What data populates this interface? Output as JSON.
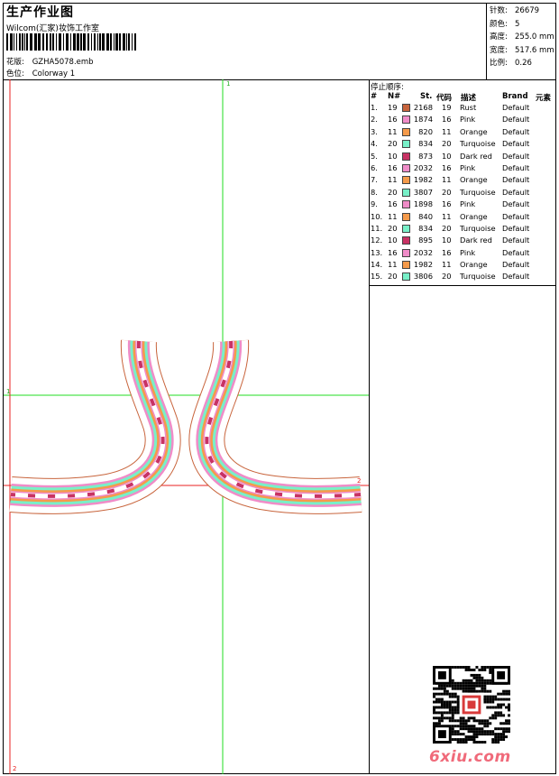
{
  "header": {
    "title": "生产作业图",
    "company": "Wilcom(汇家)妆饰工作室",
    "design_label": "花版:",
    "design_value": "GZHA5078.emb",
    "colorway_label": "色位:",
    "colorway_value": "Colorway 1"
  },
  "stats": [
    {
      "label": "针数:",
      "value": "26679"
    },
    {
      "label": "颜色:",
      "value": "5"
    },
    {
      "label": "高度:",
      "value": "255.0 mm"
    },
    {
      "label": "宽度:",
      "value": "517.6 mm"
    },
    {
      "label": "比例:",
      "value": "0.26"
    }
  ],
  "stop_sequence": {
    "title": "停止顺序:",
    "columns": {
      "n": "#",
      "needle": "N#",
      "st": "St.",
      "code": "代码",
      "desc": "描述",
      "brand": "Brand",
      "element": "元素"
    },
    "rows": [
      {
        "n": "1.",
        "needle": "19",
        "color": "#c8643c",
        "st": "2168",
        "code": "19",
        "desc": "Rust",
        "brand": "Default"
      },
      {
        "n": "2.",
        "needle": "16",
        "color": "#f08cc8",
        "st": "1874",
        "code": "16",
        "desc": "Pink",
        "brand": "Default"
      },
      {
        "n": "3.",
        "needle": "11",
        "color": "#f59a4a",
        "st": "820",
        "code": "11",
        "desc": "Orange",
        "brand": "Default"
      },
      {
        "n": "4.",
        "needle": "20",
        "color": "#78f0c8",
        "st": "834",
        "code": "20",
        "desc": "Turquoise",
        "brand": "Default"
      },
      {
        "n": "5.",
        "needle": "10",
        "color": "#c83264",
        "st": "873",
        "code": "10",
        "desc": "Dark red",
        "brand": "Default"
      },
      {
        "n": "6.",
        "needle": "16",
        "color": "#f08cc8",
        "st": "2032",
        "code": "16",
        "desc": "Pink",
        "brand": "Default"
      },
      {
        "n": "7.",
        "needle": "11",
        "color": "#f59a4a",
        "st": "1982",
        "code": "11",
        "desc": "Orange",
        "brand": "Default"
      },
      {
        "n": "8.",
        "needle": "20",
        "color": "#78f0c8",
        "st": "3807",
        "code": "20",
        "desc": "Turquoise",
        "brand": "Default"
      },
      {
        "n": "9.",
        "needle": "16",
        "color": "#f08cc8",
        "st": "1898",
        "code": "16",
        "desc": "Pink",
        "brand": "Default"
      },
      {
        "n": "10.",
        "needle": "11",
        "color": "#f59a4a",
        "st": "840",
        "code": "11",
        "desc": "Orange",
        "brand": "Default"
      },
      {
        "n": "11.",
        "needle": "20",
        "color": "#78f0c8",
        "st": "834",
        "code": "20",
        "desc": "Turquoise",
        "brand": "Default"
      },
      {
        "n": "12.",
        "needle": "10",
        "color": "#c83264",
        "st": "895",
        "code": "10",
        "desc": "Dark red",
        "brand": "Default"
      },
      {
        "n": "13.",
        "needle": "16",
        "color": "#f08cc8",
        "st": "2032",
        "code": "16",
        "desc": "Pink",
        "brand": "Default"
      },
      {
        "n": "14.",
        "needle": "11",
        "color": "#f59a4a",
        "st": "1982",
        "code": "11",
        "desc": "Orange",
        "brand": "Default"
      },
      {
        "n": "15.",
        "needle": "20",
        "color": "#78f0c8",
        "st": "3806",
        "code": "20",
        "desc": "Turquoise",
        "brand": "Default"
      }
    ]
  },
  "axis_markers": {
    "top": "1",
    "left": "1",
    "right": "2",
    "bottom": "2"
  },
  "watermark": "6xiu.com",
  "icons": {
    "qr": "qr-code-icon",
    "seal": "red-seal-icon",
    "barcode": "barcode-icon"
  }
}
